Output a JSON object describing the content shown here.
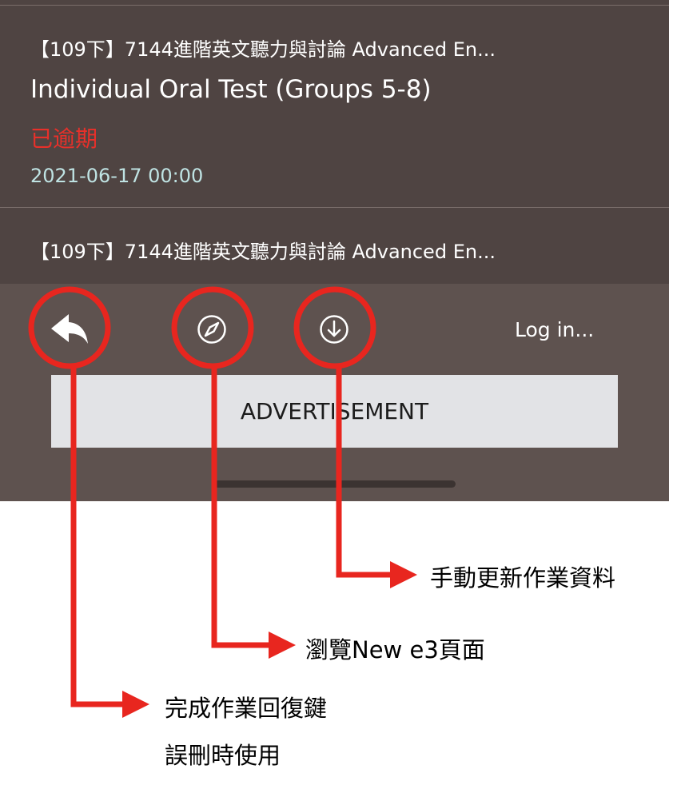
{
  "list": {
    "items": [
      {
        "course": "【109下】7144進階英文聽力與討論 Advanced En...",
        "title": "Individual Oral Test (Groups 5-8)",
        "status": "已逾期",
        "due": "2021-06-17 00:00"
      },
      {
        "course": "【109下】7144進階英文聽力與討論 Advanced En..."
      }
    ]
  },
  "toolbar": {
    "login_label": "Log in...",
    "icons": [
      "reply-icon",
      "compass-icon",
      "download-icon"
    ]
  },
  "ad": {
    "label": "ADVERTISEMENT"
  },
  "annotations": {
    "download": "手動更新作業資料",
    "browse": "瀏覽New e3頁面",
    "restore_line1": "完成作業回復鍵",
    "restore_line2": "誤刪時使用"
  },
  "colors": {
    "app_bg": "#4f4442",
    "toolbar_bg": "#5e524f",
    "overdue": "#e8302a",
    "date": "#bfe3e3",
    "callout": "#e8261f"
  }
}
